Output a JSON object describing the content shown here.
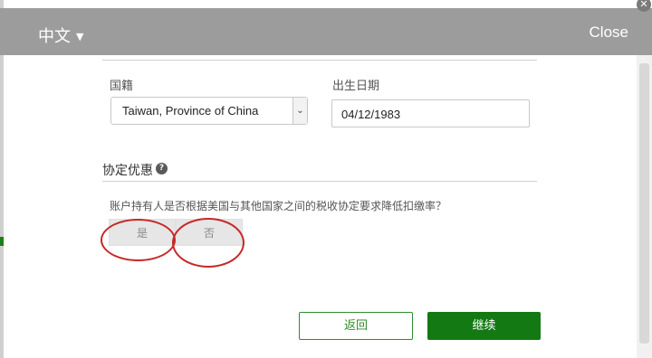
{
  "header": {
    "language": "中文",
    "close_label": "Close"
  },
  "form": {
    "nationality": {
      "label": "国籍",
      "value": "Taiwan, Province of China"
    },
    "dob": {
      "label": "出生日期",
      "value": "04/12/1983"
    }
  },
  "treaty": {
    "title": "协定优惠",
    "help_icon": "?",
    "question": "账户持有人是否根据美国与其他国家之间的税收协定要求降低扣缴率？",
    "yes_label": "是",
    "no_label": "否"
  },
  "footer": {
    "back_label": "返回",
    "continue_label": "继续"
  },
  "colors": {
    "header_bg": "#9c9c9c",
    "primary": "#137a13",
    "annotation": "#c62828"
  }
}
